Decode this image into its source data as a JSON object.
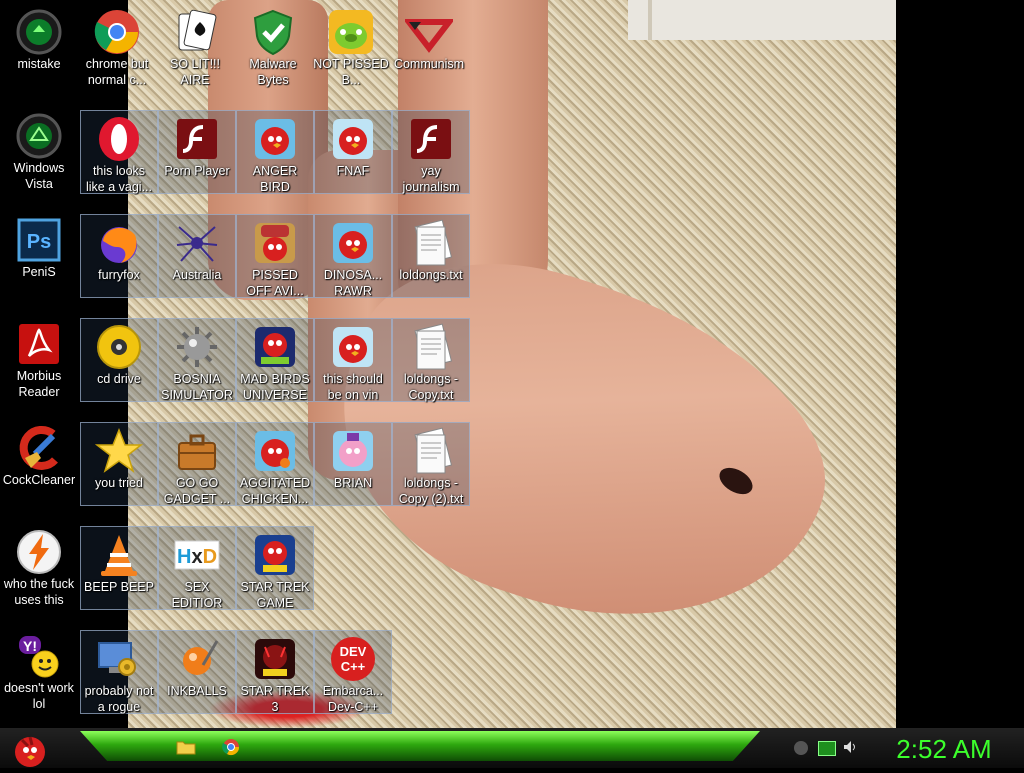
{
  "desktop": {
    "icons": [
      {
        "label": "mistake",
        "icon": "recycle-bin-green-icon"
      },
      {
        "label": "chrome but normal c...",
        "icon": "chrome-icon"
      },
      {
        "label": "SO LIT!!! AIRE",
        "icon": "solitaire-icon"
      },
      {
        "label": "Malware Bytes",
        "icon": "shield-icon"
      },
      {
        "label": "NOT PISSED B...",
        "icon": "bad-piggies-icon"
      },
      {
        "label": "Communism",
        "icon": "logo-icon"
      },
      {
        "label": "Windows Vista",
        "icon": "recycle-bin-icon"
      },
      {
        "label": "this looks like a vagi...",
        "icon": "opera-icon"
      },
      {
        "label": "Porn Player",
        "icon": "flash-icon"
      },
      {
        "label": "ANGER BIRD",
        "icon": "angry-birds-icon"
      },
      {
        "label": "FNAF",
        "icon": "angry-birds-icon"
      },
      {
        "label": "yay journalism",
        "icon": "flash-icon"
      },
      {
        "label": "PeniS",
        "icon": "photoshop-icon"
      },
      {
        "label": "furryfox",
        "icon": "firefox-icon"
      },
      {
        "label": "Australia",
        "icon": "spider-solitaire-icon"
      },
      {
        "label": "PISSED OFF AVI...",
        "icon": "angry-birds-seasons-icon"
      },
      {
        "label": "DINOSA... RAWR",
        "icon": "angry-birds-icon"
      },
      {
        "label": "loldongs.txt",
        "icon": "text-file-icon"
      },
      {
        "label": "Morbius Reader",
        "icon": "acrobat-icon"
      },
      {
        "label": "cd drive",
        "icon": "cd-icon"
      },
      {
        "label": "BOSNIA SIMULATOR",
        "icon": "minesweeper-icon"
      },
      {
        "label": "MAD BIRDS UNIVERSE",
        "icon": "angry-birds-space-icon"
      },
      {
        "label": "this should be on vin",
        "icon": "angry-birds-icon"
      },
      {
        "label": "loldongs - Copy.txt",
        "icon": "text-file-icon"
      },
      {
        "label": "CockCleaner",
        "icon": "ccleaner-icon"
      },
      {
        "label": "you tried",
        "icon": "star-icon"
      },
      {
        "label": "GO GO GADGET ...",
        "icon": "briefcase-icon"
      },
      {
        "label": "AGGITATED CHICKEN...",
        "icon": "angry-birds-icon"
      },
      {
        "label": "BRIAN",
        "icon": "angry-birds-stella-icon"
      },
      {
        "label": "loldongs - Copy (2).txt",
        "icon": "text-file-icon"
      },
      {
        "label": "who the fuck uses this",
        "icon": "winamp-icon"
      },
      {
        "label": "BEEP BEEP",
        "icon": "vlc-icon"
      },
      {
        "label": "SEX EDITIOR",
        "icon": "hxd-icon"
      },
      {
        "label": "STAR TREK GAME",
        "icon": "angry-birds-star-wars-icon"
      },
      {
        "label": "doesn't work lol",
        "icon": "yahoo-messenger-icon"
      },
      {
        "label": "probably not a rogue",
        "icon": "control-panel-icon"
      },
      {
        "label": "INKBALLS",
        "icon": "inkball-icon"
      },
      {
        "label": "STAR TREK 3",
        "icon": "angry-birds-star-wars-2-icon"
      },
      {
        "label": "Embarca... Dev-C++",
        "icon": "dev-cpp-icon"
      }
    ]
  },
  "taskbar": {
    "start_icon": "angry-bird-start-icon",
    "pinned": [
      {
        "icon": "folder-icon"
      },
      {
        "icon": "chrome-icon"
      }
    ],
    "tray": [
      {
        "icon": "network-icon"
      },
      {
        "icon": "battery-icon"
      },
      {
        "icon": "volume-icon"
      }
    ],
    "clock": "2:52 AM"
  },
  "colors": {
    "taskbar_green": "#2ea80f",
    "clock": "#3cff2c"
  }
}
